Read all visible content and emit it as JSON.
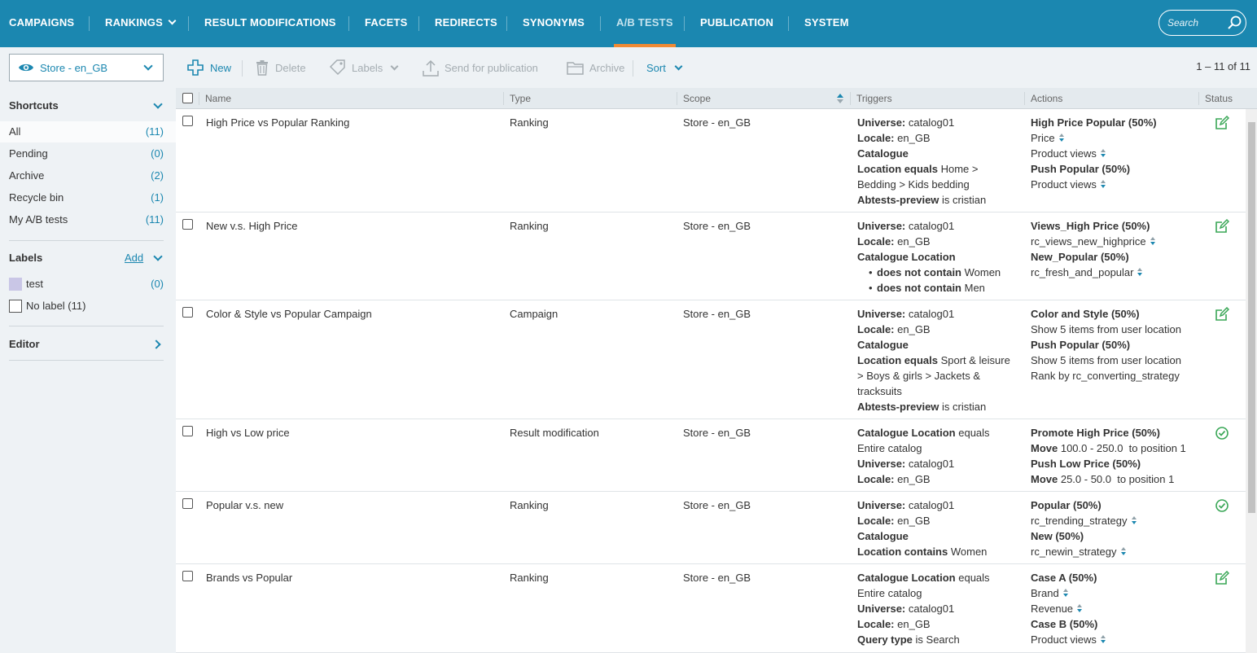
{
  "nav": {
    "items": [
      {
        "label": "CAMPAIGNS"
      },
      {
        "label": "RANKINGS"
      },
      {
        "label": "RESULT MODIFICATIONS"
      },
      {
        "label": "FACETS"
      },
      {
        "label": "REDIRECTS"
      },
      {
        "label": "SYNONYMS"
      },
      {
        "label": "A/B TESTS"
      },
      {
        "label": "PUBLICATION"
      },
      {
        "label": "SYSTEM"
      }
    ],
    "active": "A/B TESTS",
    "search_placeholder": "Search"
  },
  "sidebar": {
    "store": "Store - en_GB",
    "shortcuts_title": "Shortcuts",
    "shortcuts": [
      {
        "label": "All",
        "count": "(11)"
      },
      {
        "label": "Pending",
        "count": "(0)"
      },
      {
        "label": "Archive",
        "count": "(2)"
      },
      {
        "label": "Recycle bin",
        "count": "(1)"
      },
      {
        "label": "My A/B tests",
        "count": "(11)"
      }
    ],
    "labels_title": "Labels",
    "labels_add": "Add",
    "labels": [
      {
        "label": "test",
        "count": "(0)"
      }
    ],
    "no_label": "No label (11)",
    "editor_title": "Editor"
  },
  "toolbar": {
    "new": "New",
    "delete": "Delete",
    "labels": "Labels",
    "send": "Send for publication",
    "archive": "Archive",
    "sort": "Sort",
    "pager": "1 – 11 of 11"
  },
  "table": {
    "headers": {
      "name": "Name",
      "type": "Type",
      "scope": "Scope",
      "triggers": "Triggers",
      "actions": "Actions",
      "status": "Status"
    },
    "rows": [
      {
        "name": "High Price vs Popular Ranking",
        "type": "Ranking",
        "scope": "Store - en_GB",
        "status": "edit",
        "triggers": [
          {
            "b": "Universe:",
            "t": " catalog01"
          },
          {
            "b": "Locale:",
            "t": " en_GB"
          },
          {
            "b": "Catalogue",
            "t": ""
          },
          {
            "b": "Location equals",
            "t": " Home >"
          },
          {
            "b": "",
            "t": "Bedding > Kids bedding"
          },
          {
            "b": "Abtests-preview",
            "t": " is cristian"
          }
        ],
        "actions": [
          {
            "b": "High Price Popular (50%)",
            "t": "",
            "sort": false
          },
          {
            "b": "",
            "t": "Price",
            "sort": true
          },
          {
            "b": "",
            "t": "Product views",
            "sort": true
          },
          {
            "b": "Push Popular (50%)",
            "t": "",
            "sort": false
          },
          {
            "b": "",
            "t": "Product views",
            "sort": true
          }
        ]
      },
      {
        "name": "New v.s. High Price",
        "type": "Ranking",
        "scope": "Store - en_GB",
        "status": "edit",
        "triggers": [
          {
            "b": "Universe:",
            "t": " catalog01"
          },
          {
            "b": "Locale:",
            "t": " en_GB"
          },
          {
            "b": "Catalogue Location",
            "t": ""
          },
          {
            "bullet": true,
            "b": "does not contain",
            "t": " Women"
          },
          {
            "bullet": true,
            "b": "does not contain",
            "t": " Men"
          }
        ],
        "actions": [
          {
            "b": "Views_High Price (50%)",
            "t": "",
            "sort": false
          },
          {
            "b": "",
            "t": "rc_views_new_highprice",
            "sort": true
          },
          {
            "b": "New_Popular (50%)",
            "t": "",
            "sort": false
          },
          {
            "b": "",
            "t": "rc_fresh_and_popular",
            "sort": true
          }
        ]
      },
      {
        "name": "Color & Style vs Popular Campaign",
        "type": "Campaign",
        "scope": "Store - en_GB",
        "status": "edit",
        "triggers": [
          {
            "b": "Universe:",
            "t": " catalog01"
          },
          {
            "b": "Locale:",
            "t": " en_GB"
          },
          {
            "b": "Catalogue",
            "t": ""
          },
          {
            "b": "Location equals",
            "t": " Sport & leisure"
          },
          {
            "b": "",
            "t": "> Boys & girls > Jackets &"
          },
          {
            "b": "",
            "t": "tracksuits"
          },
          {
            "b": "Abtests-preview",
            "t": " is cristian"
          }
        ],
        "actions": [
          {
            "b": "Color and Style (50%)",
            "t": "",
            "sort": false
          },
          {
            "b": "",
            "t": "Show 5 items from user location",
            "sort": false
          },
          {
            "b": "Push Popular (50%)",
            "t": "",
            "sort": false
          },
          {
            "b": "",
            "t": "Show 5 items from user location",
            "sort": false
          },
          {
            "b": "",
            "t": "Rank by rc_converting_strategy",
            "sort": false
          }
        ]
      },
      {
        "name": "High vs Low price",
        "type": "Result modification",
        "scope": "Store - en_GB",
        "status": "published",
        "triggers": [
          {
            "b": "Catalogue Location",
            "t": " equals"
          },
          {
            "b": "",
            "t": "Entire catalog"
          },
          {
            "b": "Universe:",
            "t": " catalog01"
          },
          {
            "b": "Locale:",
            "t": " en_GB"
          }
        ],
        "actions": [
          {
            "b": "Promote High Price (50%)",
            "t": "",
            "sort": false
          },
          {
            "b": "Move",
            "t": " 100.0 - 250.0  to position 1",
            "sort": false
          },
          {
            "b": "Push Low Price (50%)",
            "t": "",
            "sort": false
          },
          {
            "b": "Move",
            "t": " 25.0 - 50.0  to position 1",
            "sort": false
          }
        ]
      },
      {
        "name": "Popular v.s. new",
        "type": "Ranking",
        "scope": "Store - en_GB",
        "status": "published",
        "triggers": [
          {
            "b": "Universe:",
            "t": " catalog01"
          },
          {
            "b": "Locale:",
            "t": " en_GB"
          },
          {
            "b": "Catalogue",
            "t": ""
          },
          {
            "b": "Location contains",
            "t": " Women"
          }
        ],
        "actions": [
          {
            "b": "Popular (50%)",
            "t": "",
            "sort": false
          },
          {
            "b": "",
            "t": "rc_trending_strategy",
            "sort": true
          },
          {
            "b": "New (50%)",
            "t": "",
            "sort": false
          },
          {
            "b": "",
            "t": "rc_newin_strategy",
            "sort": true
          }
        ]
      },
      {
        "name": "Brands vs Popular",
        "type": "Ranking",
        "scope": "Store - en_GB",
        "status": "edit",
        "triggers": [
          {
            "b": "Catalogue Location",
            "t": " equals"
          },
          {
            "b": "",
            "t": "Entire catalog"
          },
          {
            "b": "Universe:",
            "t": " catalog01"
          },
          {
            "b": "Locale:",
            "t": " en_GB"
          },
          {
            "b": "Query type",
            "t": " is Search"
          }
        ],
        "actions": [
          {
            "b": "Case A (50%)",
            "t": "",
            "sort": false
          },
          {
            "b": "",
            "t": "Brand",
            "sort": true
          },
          {
            "b": "",
            "t": "Revenue",
            "sort": true
          },
          {
            "b": "Case B (50%)",
            "t": "",
            "sort": false
          },
          {
            "b": "",
            "t": "Product views",
            "sort": true
          }
        ]
      }
    ]
  },
  "colors": {
    "brand": "#1b87b0",
    "accent": "#f08a33",
    "status_green": "#3aa757"
  }
}
